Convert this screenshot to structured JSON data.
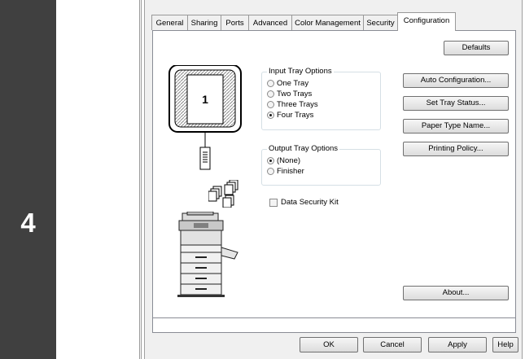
{
  "step": {
    "number": "4"
  },
  "dialog": {
    "tabs": [
      "General",
      "Sharing",
      "Ports",
      "Advanced",
      "Color Management",
      "Security",
      "Configuration"
    ],
    "active_tab": "Configuration",
    "buttons": {
      "defaults": "Defaults",
      "auto_configuration": "Auto Configuration...",
      "set_tray_status": "Set Tray Status...",
      "paper_type_name": "Paper Type Name...",
      "printing_policy": "Printing Policy...",
      "about": "About..."
    },
    "input_tray": {
      "title": "Input Tray Options",
      "options": [
        "One Tray",
        "Two Trays",
        "Three Trays",
        "Four Trays"
      ],
      "selected": "Four Trays"
    },
    "output_tray": {
      "title": "Output Tray Options",
      "options": [
        "(None)",
        "Finisher"
      ],
      "selected": "(None)"
    },
    "data_security_kit": {
      "label": "Data Security Kit",
      "checked": false
    },
    "tray_preview_number": "1",
    "footer": {
      "ok": "OK",
      "cancel": "Cancel",
      "apply": "Apply",
      "help": "Help"
    }
  }
}
